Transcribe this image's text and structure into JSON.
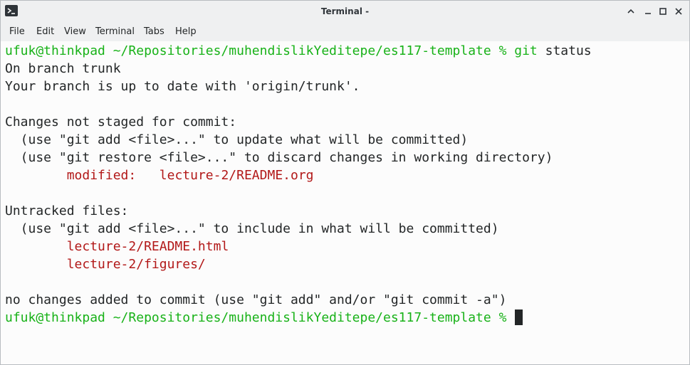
{
  "window": {
    "title": "Terminal -",
    "icons": {
      "app": "terminal-icon",
      "collapse": "chevron-up-icon",
      "minimize": "minimize-icon",
      "maximize": "maximize-icon",
      "close": "close-icon"
    }
  },
  "menu": [
    "File",
    "Edit",
    "View",
    "Terminal",
    "Tabs",
    "Help"
  ],
  "colors": {
    "prompt": "#18b218",
    "modified": "#b21818",
    "text": "#232627",
    "background": "#fcfcfc"
  },
  "terminal": {
    "prompt": "ufuk@thinkpad ~/Repositories/muhendislikYeditepe/es117-template %",
    "command_git": "git",
    "command_args": "status",
    "lines": {
      "branch": "On branch trunk",
      "uptodate": "Your branch is up to date with 'origin/trunk'.",
      "changes_header": "Changes not staged for commit:",
      "hint_add_update": "  (use \"git add <file>...\" to update what will be committed)",
      "hint_restore": "  (use \"git restore <file>...\" to discard changes in working directory)",
      "modified_label": "modified:",
      "modified_file": "lecture-2/README.org",
      "untracked_header": "Untracked files:",
      "hint_add_include": "  (use \"git add <file>...\" to include in what will be committed)",
      "untracked_1": "lecture-2/README.html",
      "untracked_2": "lecture-2/figures/",
      "summary": "no changes added to commit (use \"git add\" and/or \"git commit -a\")"
    }
  }
}
